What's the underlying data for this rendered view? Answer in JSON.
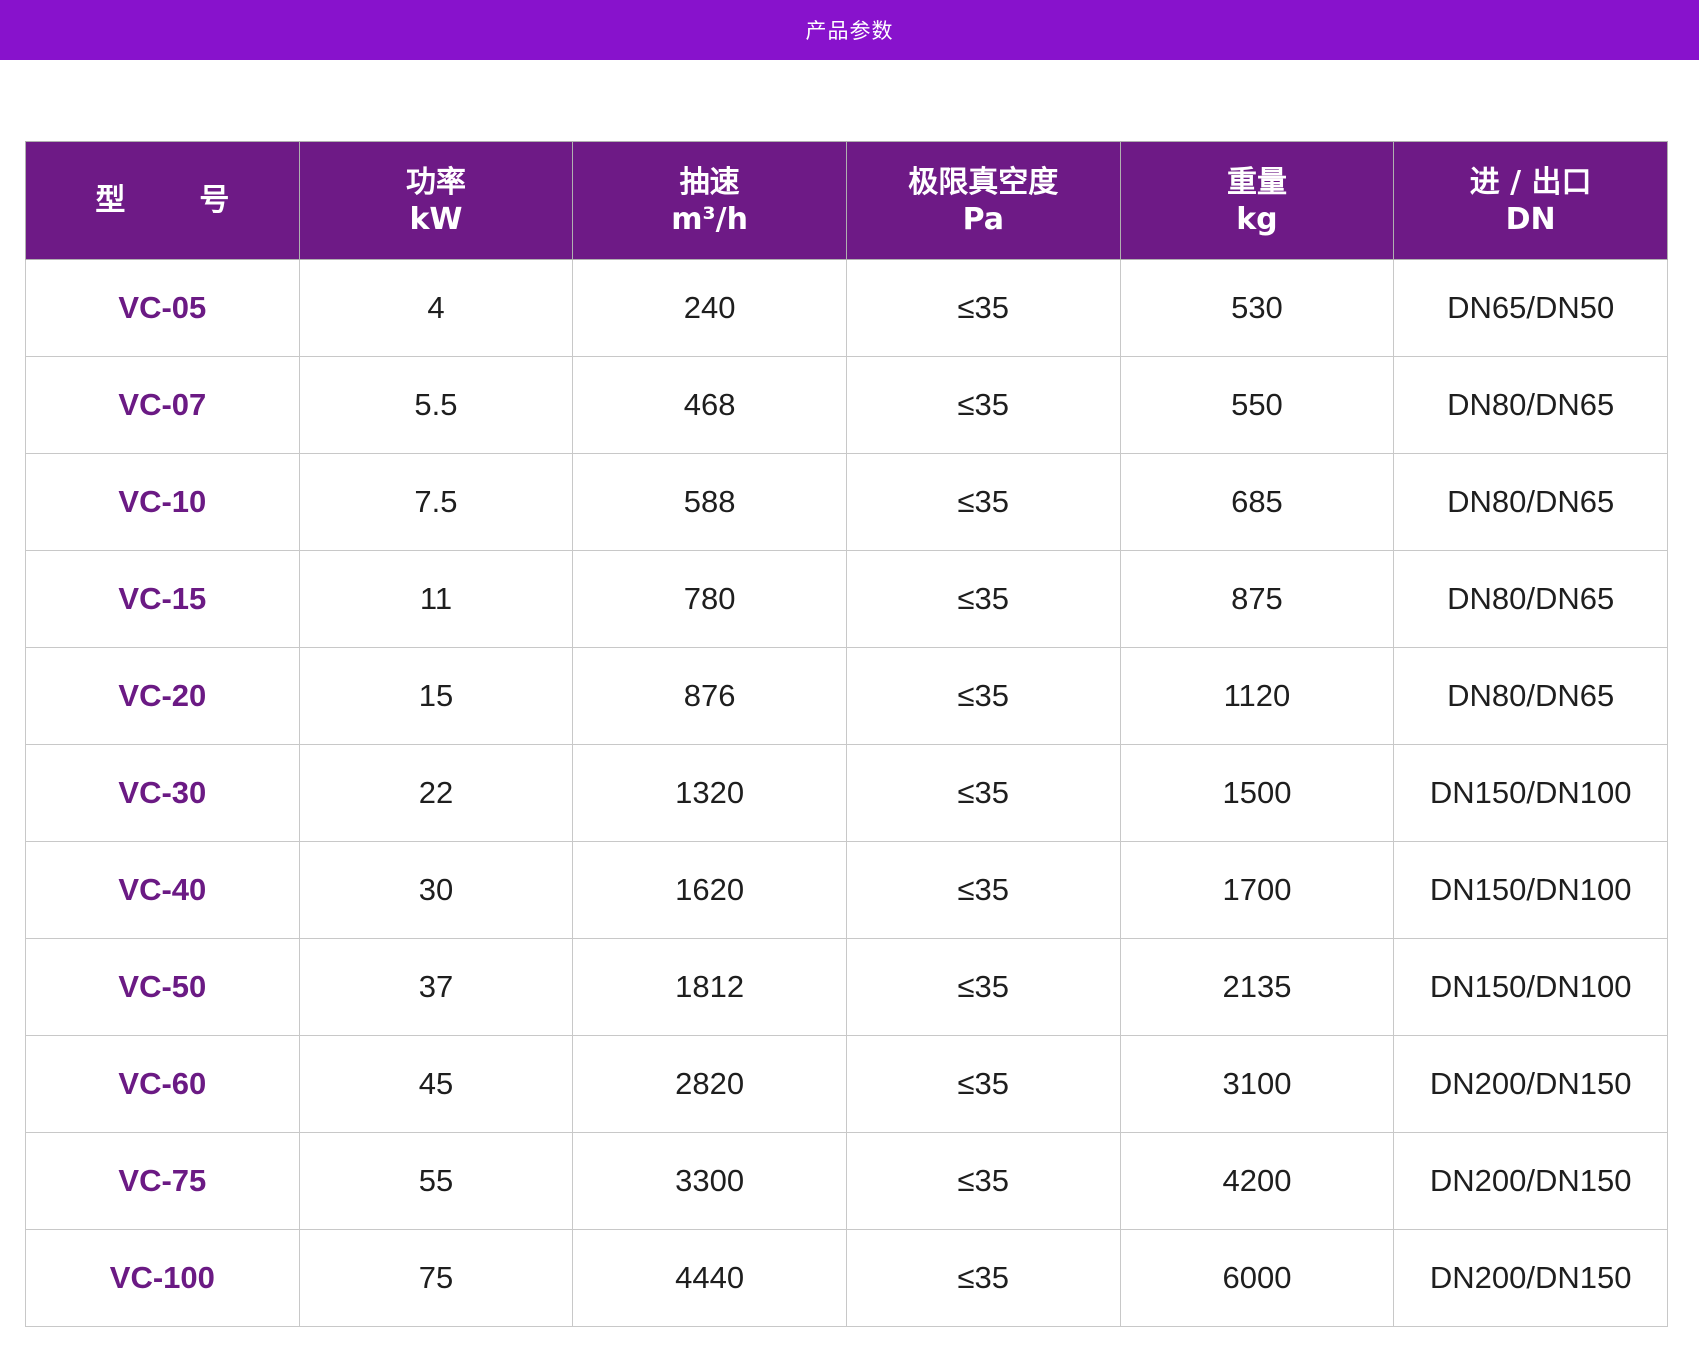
{
  "header_bar": {
    "title": "产品参数"
  },
  "table": {
    "columns": [
      {
        "line1": "型　号",
        "line2": ""
      },
      {
        "line1": "功率",
        "line2": "kW"
      },
      {
        "line1": "抽速",
        "line2": "m³/h"
      },
      {
        "line1": "极限真空度",
        "line2": "Pa"
      },
      {
        "line1": "重量",
        "line2": "kg"
      },
      {
        "line1": "进 / 出口",
        "line2": "DN"
      }
    ],
    "rows": [
      {
        "model": "VC-05",
        "power": "4",
        "speed": "240",
        "vacuum": "≤35",
        "weight": "530",
        "port": "DN65/DN50"
      },
      {
        "model": "VC-07",
        "power": "5.5",
        "speed": "468",
        "vacuum": "≤35",
        "weight": "550",
        "port": "DN80/DN65"
      },
      {
        "model": "VC-10",
        "power": "7.5",
        "speed": "588",
        "vacuum": "≤35",
        "weight": "685",
        "port": "DN80/DN65"
      },
      {
        "model": "VC-15",
        "power": "11",
        "speed": "780",
        "vacuum": "≤35",
        "weight": "875",
        "port": "DN80/DN65"
      },
      {
        "model": "VC-20",
        "power": "15",
        "speed": "876",
        "vacuum": "≤35",
        "weight": "1120",
        "port": "DN80/DN65"
      },
      {
        "model": "VC-30",
        "power": "22",
        "speed": "1320",
        "vacuum": "≤35",
        "weight": "1500",
        "port": "DN150/DN100"
      },
      {
        "model": "VC-40",
        "power": "30",
        "speed": "1620",
        "vacuum": "≤35",
        "weight": "1700",
        "port": "DN150/DN100"
      },
      {
        "model": "VC-50",
        "power": "37",
        "speed": "1812",
        "vacuum": "≤35",
        "weight": "2135",
        "port": "DN150/DN100"
      },
      {
        "model": "VC-60",
        "power": "45",
        "speed": "2820",
        "vacuum": "≤35",
        "weight": "3100",
        "port": "DN200/DN150"
      },
      {
        "model": "VC-75",
        "power": "55",
        "speed": "3300",
        "vacuum": "≤35",
        "weight": "4200",
        "port": "DN200/DN150"
      },
      {
        "model": "VC-100",
        "power": "75",
        "speed": "4440",
        "vacuum": "≤35",
        "weight": "6000",
        "port": "DN200/DN150"
      }
    ]
  },
  "colors": {
    "top_bar": "#8812cc",
    "table_header": "#6e1a86",
    "model_text": "#6b1a84"
  }
}
